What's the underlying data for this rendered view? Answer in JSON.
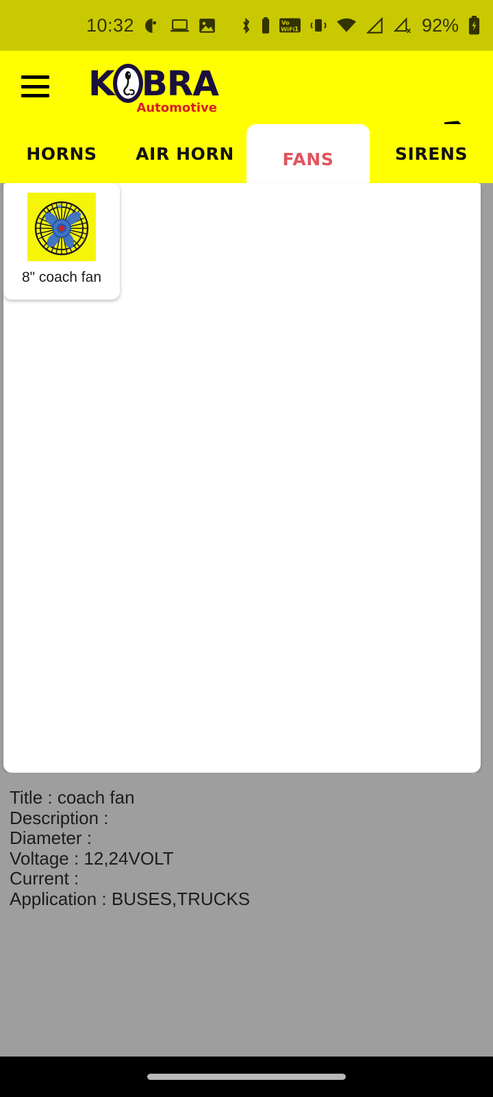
{
  "status_bar": {
    "time": "10:32",
    "battery_percent": "92%",
    "left_icons": [
      "pie-chart-icon",
      "laptop-icon",
      "image-icon"
    ],
    "right_icons": [
      "bluetooth-icon",
      "bluetooth-battery-icon",
      "vowifi-icon",
      "vibrate-icon",
      "wifi-icon",
      "signal-icon",
      "signal-off-icon"
    ],
    "battery_icon": "charging-battery-icon",
    "background_color": "#c9c901",
    "foreground_color": "#333300"
  },
  "header": {
    "menu_icon": "hamburger-menu-icon",
    "brand_prefix": "K",
    "brand_suffix": "BRA",
    "brand_o_icon": "cobra-logo-icon",
    "brand_subtitle": "Automotive",
    "tag_icon": "price-tag-icon",
    "background_color": "#ffff00",
    "brand_color": "#1a1040",
    "subtitle_color": "#d81f26"
  },
  "tabs": {
    "active_index": 2,
    "active_color": "#e2535c",
    "items": [
      {
        "label": "HORNS"
      },
      {
        "label": "AIR HORN"
      },
      {
        "label": "FANS"
      },
      {
        "label": "SIRENS"
      }
    ]
  },
  "products": [
    {
      "label": "8\" coach fan",
      "thumb_icon": "coach-fan-image",
      "thumb_bg": "#f5f50a"
    }
  ],
  "details": {
    "background_color": "#9e9e9e",
    "lines": [
      "Title : coach fan",
      "Description :",
      "Diameter :",
      "Voltage : 12,24VOLT",
      "Current :",
      "Application : BUSES,TRUCKS"
    ]
  },
  "nav_bar": {
    "gesture_handle": "home-gesture-pill",
    "background_color": "#000000"
  }
}
